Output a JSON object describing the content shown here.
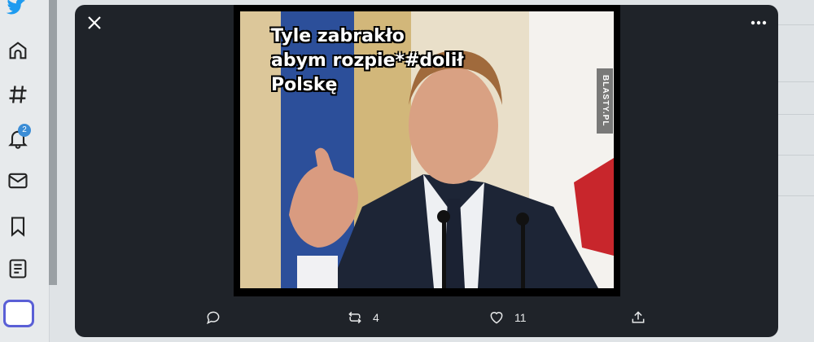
{
  "sidebar": {
    "items": [
      {
        "icon": "home-icon"
      },
      {
        "icon": "hashtag-icon"
      },
      {
        "icon": "bell-icon"
      },
      {
        "icon": "mail-icon"
      },
      {
        "icon": "bookmark-icon"
      },
      {
        "icon": "list-icon"
      }
    ],
    "notifications_badge": "2"
  },
  "modal": {
    "media": {
      "caption_lines": [
        "Tyle zabrakło",
        "abym rozpie*#dolił",
        "Polskę"
      ],
      "watermark": "BLASTY.PL"
    },
    "actions": {
      "reply_icon": "reply-icon",
      "retweet_count": "4",
      "like_count": "11",
      "share_icon": "share-icon"
    }
  },
  "colors": {
    "modal_bg": "#1f2329",
    "badge": "#3b8dd6",
    "compose_border": "#5a5fd6"
  }
}
